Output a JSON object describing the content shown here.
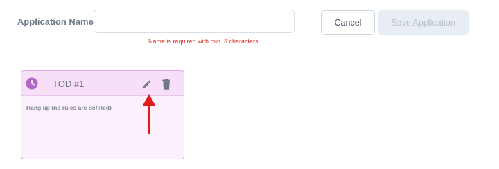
{
  "form": {
    "name_label": "Application Name:",
    "name_value": "",
    "name_placeholder": "",
    "error_message": "Name is required with min. 3 characters"
  },
  "buttons": {
    "cancel_label": "Cancel",
    "save_label": "Save Application"
  },
  "rule_card": {
    "title": "TOD #1",
    "description": "Hang up (no rules are defined)",
    "icons": [
      "clock-icon",
      "pencil-icon",
      "trash-icon"
    ]
  },
  "colors": {
    "error": "#d9362c",
    "card_border": "#dda6e3",
    "card_background": "#fdf0fd",
    "card_header": "#f7dff8",
    "clock_icon": "#b067c4",
    "annotation_arrow": "#e01b1b",
    "save_disabled_bg": "#e9eef5"
  }
}
